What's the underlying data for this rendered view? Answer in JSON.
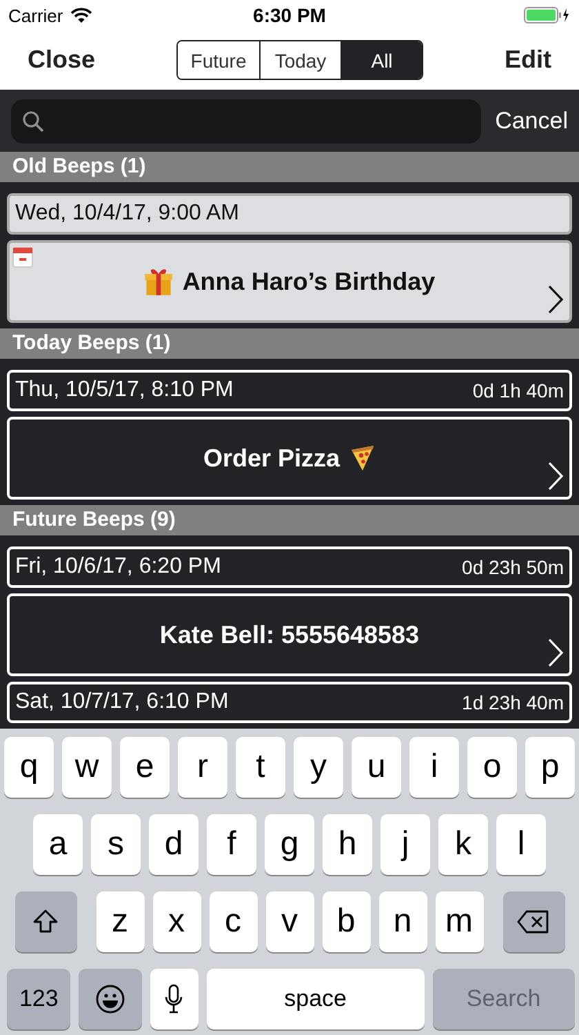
{
  "status_bar": {
    "carrier": "Carrier",
    "time": "6:30 PM"
  },
  "nav": {
    "left": "Close",
    "right": "Edit",
    "tabs": [
      {
        "label": "Future",
        "selected": false
      },
      {
        "label": "Today",
        "selected": false
      },
      {
        "label": "All",
        "selected": true
      }
    ]
  },
  "search": {
    "cancel": "Cancel"
  },
  "sections": [
    {
      "title": "Old Beeps (1)",
      "past": true,
      "beeps": [
        {
          "date": "Wed, 10/4/17, 9:00 AM",
          "title": "Anna Haro’s Birthday",
          "kind": "birthday",
          "calendar": true
        }
      ]
    },
    {
      "title": "Today Beeps (1)",
      "past": false,
      "beeps": [
        {
          "date": "Thu, 10/5/17, 8:10 PM",
          "countdown": "0d 1h 40m",
          "title": "Order Pizza",
          "kind": "food",
          "calendar": false
        }
      ]
    },
    {
      "title": "Future Beeps (9)",
      "past": false,
      "beeps": [
        {
          "date": "Fri, 10/6/17, 6:20 PM",
          "countdown": "0d 23h 50m",
          "title": "Kate Bell: 5555648583",
          "kind": "call",
          "calendar": false
        },
        {
          "date": "Sat, 10/7/17, 6:10 PM",
          "countdown": "1d 23h 40m"
        }
      ]
    }
  ],
  "keyboard": {
    "rows": [
      [
        "q",
        "w",
        "e",
        "r",
        "t",
        "y",
        "u",
        "i",
        "o",
        "p"
      ],
      [
        "a",
        "s",
        "d",
        "f",
        "g",
        "h",
        "j",
        "k",
        "l"
      ],
      [
        "z",
        "x",
        "c",
        "v",
        "b",
        "n",
        "m"
      ]
    ],
    "numbers": "123",
    "space": "space",
    "search": {
      "label": "Search",
      "disabled": true
    }
  }
}
